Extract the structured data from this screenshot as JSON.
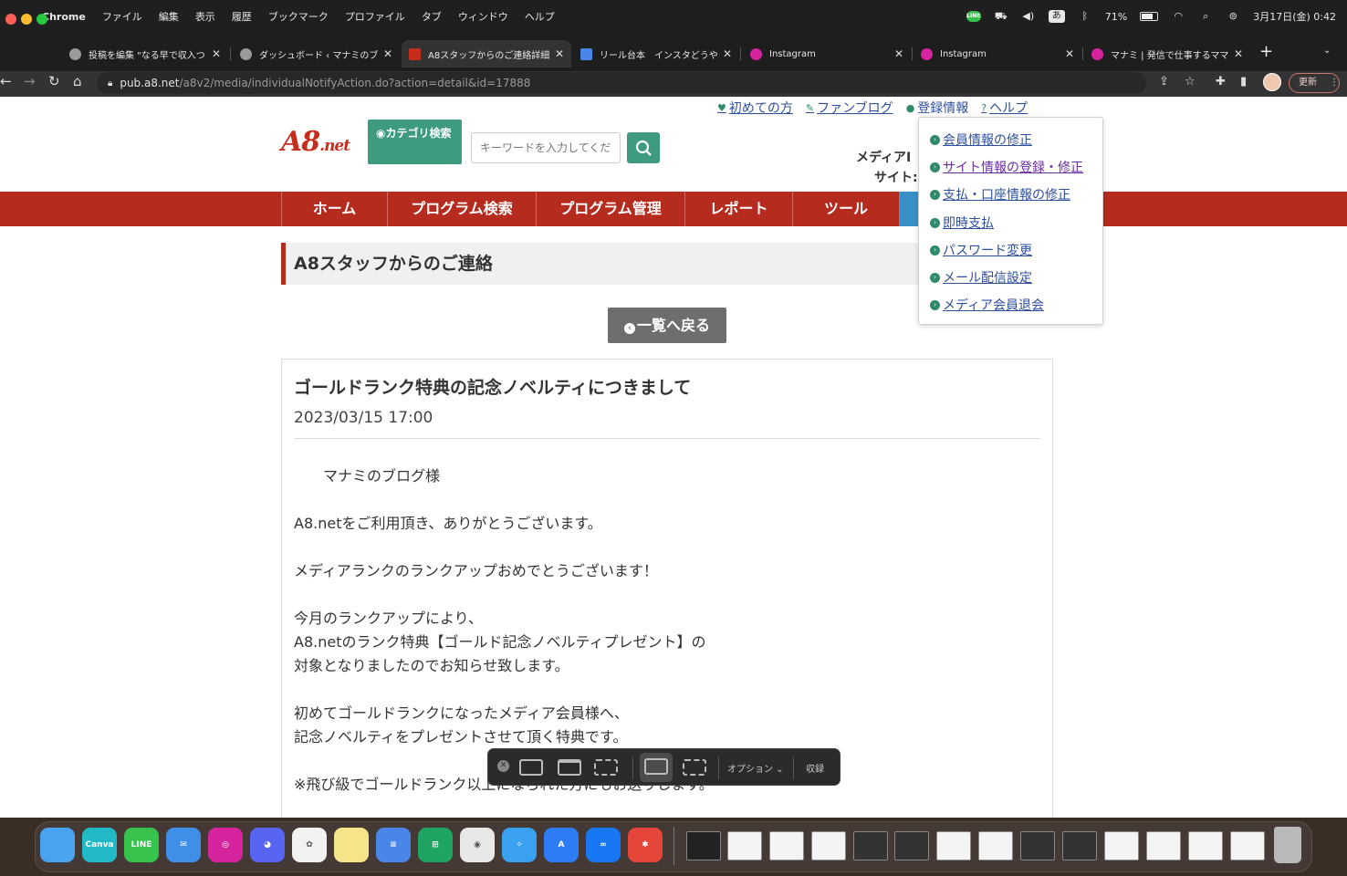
{
  "menubar": {
    "app": "Chrome",
    "items": [
      "ファイル",
      "編集",
      "表示",
      "履歴",
      "ブックマーク",
      "プロファイル",
      "タブ",
      "ウィンドウ",
      "ヘルプ"
    ],
    "line_icon": "LINE",
    "ime": "あ",
    "battery": "71%",
    "datetime": "3月17日(金) 0:42"
  },
  "tabs": [
    {
      "label": "投稿を編集 \"なる早で収入つく",
      "icon": "wordpress-icon",
      "color": "#9a9a9a"
    },
    {
      "label": "ダッシュボード ‹ マナミのブロ",
      "icon": "wordpress-icon",
      "color": "#9a9a9a"
    },
    {
      "label": "A8スタッフからのご連絡詳細",
      "icon": "a8-icon",
      "color": "#c72d1d"
    },
    {
      "label": "リール台本　インスタどうや",
      "icon": "google-docs-icon",
      "color": "#4a86e8"
    },
    {
      "label": "Instagram",
      "icon": "instagram-icon",
      "color": "#d6249f"
    },
    {
      "label": "Instagram",
      "icon": "instagram-icon",
      "color": "#d6249f"
    },
    {
      "label": "マナミ | 発信で仕事するママ(",
      "icon": "instagram-icon",
      "color": "#d6249f"
    }
  ],
  "address": {
    "host": "pub.a8.net",
    "path": "/a8v2/media/individualNotifyAction.do?action=detail&id=17888",
    "update_label": "更新"
  },
  "site": {
    "toplinks": [
      "初めての方",
      "ファンブログ",
      "登録情報",
      "ヘルプ"
    ],
    "logo_main": "A8",
    "logo_sub": ".net",
    "category_button": "カテゴリ検索",
    "search_placeholder": "キーワードを入力してください",
    "media_label": "メディアI",
    "site_label": "サイト:",
    "nav": [
      "ホーム",
      "プログラム検索",
      "プログラム管理",
      "レポート",
      "ツール"
    ]
  },
  "dropdown": [
    "会員情報の修正",
    "サイト情報の登録・修正",
    "支払・口座情報の修正",
    "即時支払",
    "パスワード変更",
    "メール配信設定",
    "メディア会員退会"
  ],
  "content": {
    "section_title": "A8スタッフからのご連絡",
    "back_button": "一覧へ戻る",
    "article_title": "ゴールドランク特典の記念ノベルティにつきまして",
    "article_date": "2023/03/15 17:00",
    "lines": [
      "　　マナミのブログ様",
      "A8.netをご利用頂き、ありがとうございます。",
      "メディアランクのランクアップおめでとうございます！",
      "今月のランクアップにより、",
      "A8.netのランク特典【ゴールド記念ノベルティプレゼント】の",
      "対象となりましたのでお知らせ致します。",
      "初めてゴールドランクになったメディア会員様へ、",
      "記念ノベルティをプレゼントさせて頂く特典です。",
      "※飛び級でゴールドランク以上になられた方にもお送りします。"
    ]
  },
  "screenshot_toolbar": {
    "options_label": "オプション",
    "capture_label": "収録"
  },
  "dock": {
    "apps": [
      {
        "name": "finder-icon",
        "color": "#4aa3f0",
        "label": ""
      },
      {
        "name": "canva-icon",
        "color": "#22b9c7",
        "label": "Canva"
      },
      {
        "name": "line-icon",
        "color": "#37c24b",
        "label": "LINE"
      },
      {
        "name": "mail-icon",
        "color": "#3f8fe8",
        "label": "✉"
      },
      {
        "name": "instagram-icon",
        "color": "#d6249f",
        "label": "◎"
      },
      {
        "name": "discord-icon",
        "color": "#5865f2",
        "label": "◕"
      },
      {
        "name": "photos-icon",
        "color": "#f2f2f2",
        "label": "✿"
      },
      {
        "name": "notes-icon",
        "color": "#f6e48a",
        "label": ""
      },
      {
        "name": "google-docs-icon",
        "color": "#4a86e8",
        "label": "≡"
      },
      {
        "name": "google-sheets-icon",
        "color": "#1fa463",
        "label": "⊞"
      },
      {
        "name": "chrome-icon",
        "color": "#e8e8e8",
        "label": "◉"
      },
      {
        "name": "safari-icon",
        "color": "#3aa0f0",
        "label": "✧"
      },
      {
        "name": "app-store-icon",
        "color": "#2d7cf6",
        "label": "A"
      },
      {
        "name": "meta-icon",
        "color": "#1877f2",
        "label": "∞"
      },
      {
        "name": "xmind-icon",
        "color": "#e6463a",
        "label": "✱"
      }
    ]
  }
}
